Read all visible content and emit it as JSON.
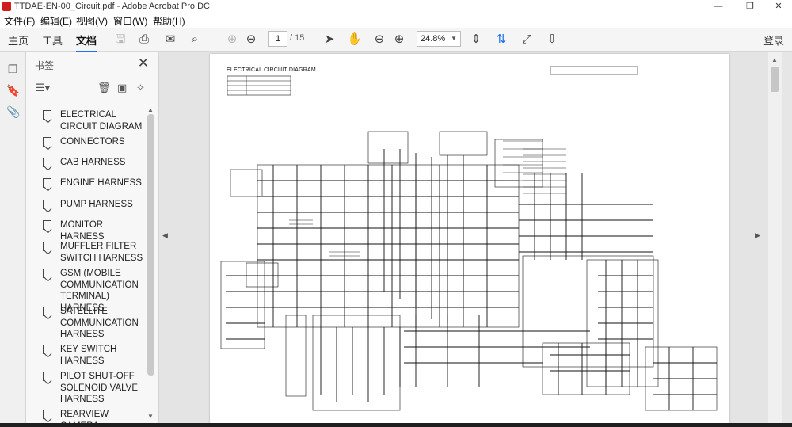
{
  "window": {
    "title": "TTDAE-EN-00_Circuit.pdf - Adobe Acrobat Pro DC",
    "controls": {
      "minimize": "—",
      "maximize": "❐",
      "close": "✕"
    }
  },
  "menu": [
    {
      "label": "文件(F)"
    },
    {
      "label": "编辑(E)"
    },
    {
      "label": "视图(V)"
    },
    {
      "label": "窗口(W)"
    },
    {
      "label": "帮助(H)"
    }
  ],
  "tabs": [
    {
      "label": "主页"
    },
    {
      "label": "工具"
    },
    {
      "label": "文档"
    }
  ],
  "toolbar": {
    "page_current": "1",
    "page_total": "/ 15",
    "zoom": "24.8%",
    "login": "登录"
  },
  "bookmarks": {
    "header": "书签",
    "items": [
      {
        "label": "ELECTRICAL CIRCUIT DIAGRAM"
      },
      {
        "label": "CONNECTORS"
      },
      {
        "label": "CAB HARNESS"
      },
      {
        "label": "ENGINE HARNESS"
      },
      {
        "label": "PUMP HARNESS"
      },
      {
        "label": "MONITOR HARNESS"
      },
      {
        "label": "MUFFLER FILTER SWITCH HARNESS"
      },
      {
        "label": "GSM (MOBILE COMMUNICATION TERMINAL) HARNESS"
      },
      {
        "label": "SATELLITE COMMUNICATION HARNESS"
      },
      {
        "label": "KEY SWITCH HARNESS"
      },
      {
        "label": "PILOT SHUT-OFF SOLENOID VALVE HARNESS"
      },
      {
        "label": "REARVIEW CAMERA"
      }
    ]
  },
  "document": {
    "diagram_title": "ELECTRICAL CIRCUIT DIAGRAM"
  }
}
